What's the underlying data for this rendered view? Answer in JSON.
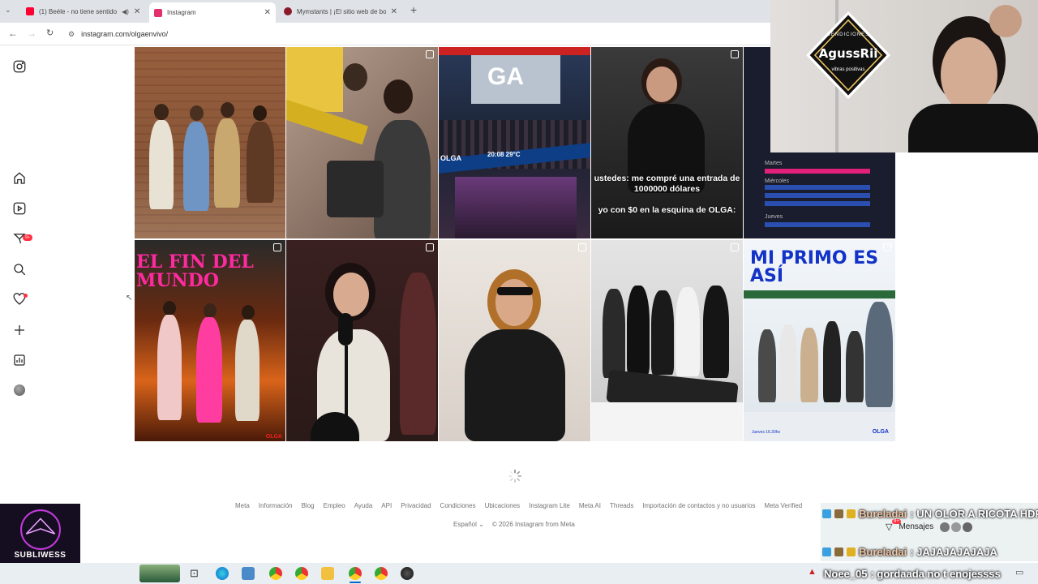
{
  "browser": {
    "tabs": [
      {
        "label": "(1) Beéle - no tiene sentido",
        "color": "#ff0033"
      },
      {
        "label": "Instagram",
        "color": "#e1306c"
      },
      {
        "label": "Mymstants | ¡El sitio web de bo",
        "color": "#8b1a2b"
      }
    ],
    "url": "instagram.com/olgaenvivo/"
  },
  "posts": [
    {
      "caption": ""
    },
    {
      "caption": ""
    },
    {
      "caption": "20:08  29°C   ",
      "sign": "GA",
      "ticker": "OLGA"
    },
    {
      "caption": "ustedes: me compré una entrada de 1000000 dólares\n\nyo con $0 en la esquina de OLGA:"
    },
    {
      "caption": "Martes",
      "lines": [
        "Miércoles",
        "Jueves"
      ]
    },
    {
      "caption": "EL FIN DEL MUNDO",
      "corner_left": "",
      "corner_right": "OLGA"
    },
    {
      "caption": ""
    },
    {
      "caption": ""
    },
    {
      "caption": ""
    },
    {
      "caption": "MI PRIMO ES ASÍ",
      "corner_right": "OLGA",
      "corner_left": "Jueves 16.30hs"
    }
  ],
  "footer": {
    "links": [
      "Meta",
      "Información",
      "Blog",
      "Empleo",
      "Ayuda",
      "API",
      "Privacidad",
      "Condiciones",
      "Ubicaciones",
      "Instagram Lite",
      "Meta AI",
      "Threads",
      "Importación de contactos y no usuarios",
      "Meta Verified"
    ],
    "language": "Español",
    "copyright": "© 2026 Instagram from Meta"
  },
  "notification_badge": "9+",
  "webcam": {
    "logo_top": "BENDICIONES",
    "logo_name": "AgussRii",
    "logo_bottom": "vibras positivas"
  },
  "stream_logo": {
    "name": "SUBLIWESS",
    "tagline": "DIVIERTE ADMIRATE"
  },
  "chat": [
    {
      "user": "Bureladai",
      "message": ": UN OLOR A RICOTA HDP"
    },
    {
      "user": "Bureladai",
      "message": ": JAJAJAJAJAJA"
    }
  ],
  "messages_button": "Mensajes",
  "messages_badge": "9+",
  "bottom_chat": {
    "user": "Noee_05",
    "message": ": gordaada no t enojessss"
  },
  "colors": {
    "instagram_red": "#ff3040",
    "taskbar": "#e9eef2"
  }
}
